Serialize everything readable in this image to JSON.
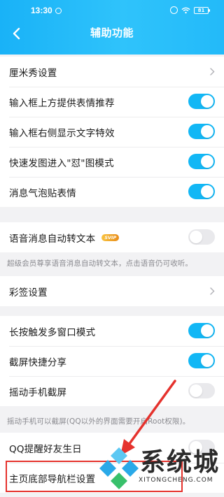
{
  "status_bar": {
    "time": "13:30",
    "battery": "81"
  },
  "nav": {
    "title": "辅助功能"
  },
  "section1": [
    {
      "label": "厘米秀设置",
      "control": "chevron"
    },
    {
      "label": "输入框上方提供表情推荐",
      "control": "toggle",
      "on": true
    },
    {
      "label": "输入框右侧显示文字特效",
      "control": "toggle",
      "on": true
    },
    {
      "label": "快速发图进入\"怼\"图模式",
      "control": "toggle",
      "on": true
    },
    {
      "label": "消息气泡贴表情",
      "control": "toggle",
      "on": true
    }
  ],
  "section2": {
    "label": "语音消息自动转文本",
    "badge": "SVIP",
    "on": false,
    "note": "超级会员尊享语音消息自动转文本，点击语音仍可收听。"
  },
  "section3": {
    "label": "彩签设置"
  },
  "section4": [
    {
      "label": "长按触发多窗口模式",
      "on": true
    },
    {
      "label": "截屏快捷分享",
      "on": true
    },
    {
      "label": "摇动手机截屏",
      "on": false
    }
  ],
  "section4_note": "摇动手机可以截屏(QQ以外的界面需要开启Root权限)。",
  "section5": [
    {
      "label": "QQ提醒好友生日",
      "on": false
    },
    {
      "label": "主页底部导航栏设置"
    }
  ],
  "watermark": {
    "text": "系统城",
    "subtext": "XITONGCHENG.COM"
  },
  "colors": {
    "header": "#19b2f7",
    "toggle_on": "#12b7f5",
    "highlight": "#e5322d"
  }
}
